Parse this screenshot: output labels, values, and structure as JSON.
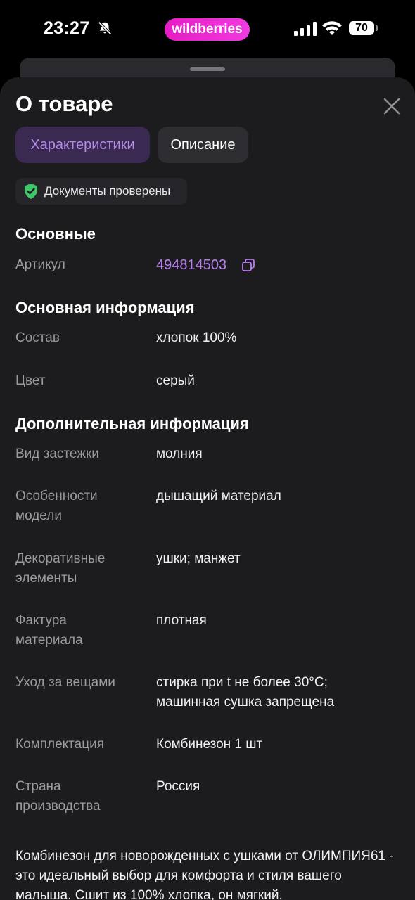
{
  "status_bar": {
    "time": "23:27",
    "brand": "wildberries",
    "battery": "70",
    "icons": [
      "bell-slash-icon",
      "cellular-signal-icon",
      "wifi-icon",
      "battery-icon"
    ]
  },
  "sheet": {
    "title": "О товаре",
    "tabs": [
      {
        "label": "Характеристики",
        "active": true
      },
      {
        "label": "Описание",
        "active": false
      }
    ],
    "verified_badge": "Документы проверены"
  },
  "sections": {
    "basic": {
      "title": "Основные",
      "article_label": "Артикул",
      "article_value": "494814503"
    },
    "main_info": {
      "title": "Основная информация",
      "rows": [
        {
          "label": "Состав",
          "value": "хлопок 100%"
        },
        {
          "label": "Цвет",
          "value": "серый"
        }
      ]
    },
    "additional": {
      "title": "Дополнительная информация",
      "rows": [
        {
          "label": "Вид застежки",
          "value": "молния"
        },
        {
          "label": "Особенности модели",
          "value": "дышащий материал"
        },
        {
          "label": "Декоративные элементы",
          "value": "ушки; манжет"
        },
        {
          "label": "Фактура материала",
          "value": "плотная"
        },
        {
          "label": "Уход за вещами",
          "value": "стирка при t не более 30°С; машинная сушка запрещена"
        },
        {
          "label": "Комплектация",
          "value": "Комбинезон 1 шт"
        },
        {
          "label": "Страна производства",
          "value": "Россия"
        }
      ]
    }
  },
  "description": "Комбинезон для новорожденных с ушками от ОЛИМПИЯ61 - это идеальный выбор для комфорта и стиля вашего малыша. Сшит из 100% хлопка, он мягкий,",
  "colors": {
    "background": "#1c1c1f",
    "accent": "#b87ff0",
    "brand": "#e61cc4",
    "verified_green": "#3ec86a"
  }
}
